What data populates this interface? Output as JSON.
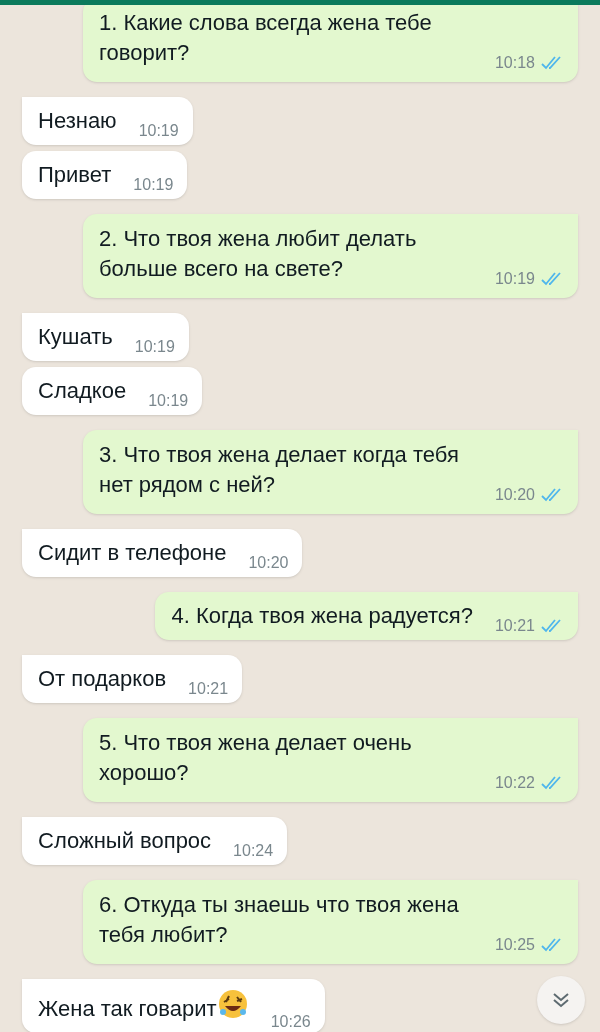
{
  "messages": [
    {
      "outgoing": true,
      "text": "1. Какие слова всегда жена тебе\nговорит?",
      "time": "10:18",
      "read": true
    },
    {
      "outgoing": false,
      "text": "Незнаю",
      "time": "10:19"
    },
    {
      "outgoing": false,
      "text": "Привет",
      "time": "10:19"
    },
    {
      "outgoing": true,
      "text": "2. Что твоя жена любит делать\nбольше всего на свете?",
      "time": "10:19",
      "read": true
    },
    {
      "outgoing": false,
      "text": "Кушать",
      "time": "10:19"
    },
    {
      "outgoing": false,
      "text": "Сладкое",
      "time": "10:19"
    },
    {
      "outgoing": true,
      "text": "3. Что твоя жена делает когда тебя\nнет рядом с ней?",
      "time": "10:20",
      "read": true
    },
    {
      "outgoing": false,
      "text": "Сидит в телефоне",
      "time": "10:20"
    },
    {
      "outgoing": true,
      "text": "4. Когда твоя жена радуется?",
      "time": "10:21",
      "read": true
    },
    {
      "outgoing": false,
      "text": "От подарков",
      "time": "10:21"
    },
    {
      "outgoing": true,
      "text": "5. Что твоя жена делает очень\nхорошо?",
      "time": "10:22",
      "read": true
    },
    {
      "outgoing": false,
      "text": "Сложный вопрос",
      "time": "10:24"
    },
    {
      "outgoing": true,
      "text": "6. Откуда ты знаешь что твоя жена\nтебя любит?",
      "time": "10:25",
      "read": true
    },
    {
      "outgoing": false,
      "text": "Жена так говарит",
      "time": "10:26",
      "emoji": true
    }
  ]
}
